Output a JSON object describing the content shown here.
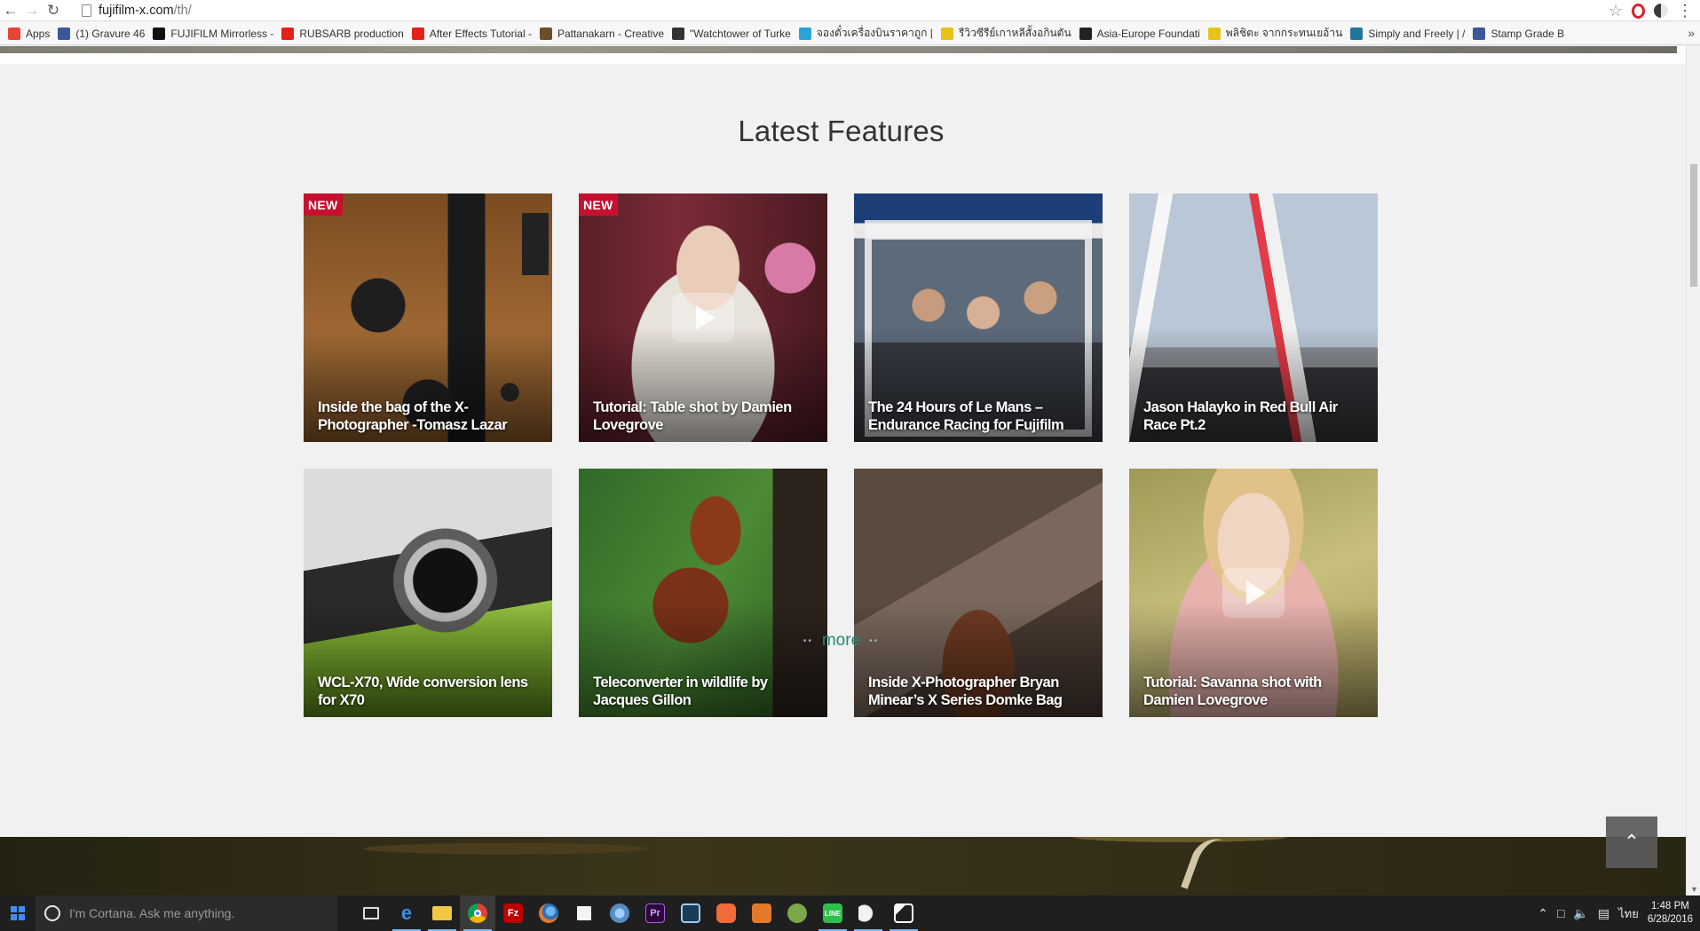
{
  "browser": {
    "url_host": "fujifilm-x.com",
    "url_path": "/th/",
    "bookmarks": [
      {
        "label": "Apps",
        "icon": "apps-grid-icon",
        "color": "#e94335"
      },
      {
        "label": "(1) Gravure 46",
        "icon": "facebook-icon",
        "color": "#3b5998"
      },
      {
        "label": "FUJIFILM Mirrorless -",
        "icon": "fujifilm-x-icon",
        "color": "#111111"
      },
      {
        "label": "RUBSARB production",
        "icon": "youtube-icon",
        "color": "#e62117"
      },
      {
        "label": "After Effects Tutorial -",
        "icon": "youtube-icon",
        "color": "#e62117"
      },
      {
        "label": "Pattanakarn - Creative",
        "icon": "page-icon",
        "color": "#6b4f2a"
      },
      {
        "label": "\"Watchtower of Turke",
        "icon": "film-icon",
        "color": "#333333"
      },
      {
        "label": "จองตั๋วเครื่องบินราคาถูก |",
        "icon": "plane-icon",
        "color": "#2aa3d9"
      },
      {
        "label": "รีวิวซีรีย์เกาหลีสั้งอกินตัน",
        "icon": "smiley-icon",
        "color": "#e8c21a"
      },
      {
        "label": "Asia-Europe Foundati",
        "icon": "asef-icon",
        "color": "#222222"
      },
      {
        "label": "พลิชิตะ จากกระทนเยอ้าน",
        "icon": "smiley-icon",
        "color": "#e8c21a"
      },
      {
        "label": "Simply and Freely | /",
        "icon": "wordpress-icon",
        "color": "#21759b"
      },
      {
        "label": "Stamp Grade B",
        "icon": "facebook-icon",
        "color": "#3b5998"
      }
    ]
  },
  "section": {
    "title": "Latest Features",
    "more_label": "more"
  },
  "features": [
    {
      "title": "Inside the bag of the X-Photographer -Tomasz Lazar",
      "badge": "NEW",
      "video": false
    },
    {
      "title": "Tutorial: Table shot by Damien Lovegrove",
      "badge": "NEW",
      "video": true
    },
    {
      "title": "The 24 Hours of Le Mans – Endurance Racing for Fujifilm",
      "badge": "",
      "video": false
    },
    {
      "title": "Jason Halayko in Red Bull Air Race Pt.2",
      "badge": "",
      "video": false
    },
    {
      "title": "WCL-X70, Wide conversion lens for X70",
      "badge": "",
      "video": false
    },
    {
      "title": "Teleconverter in wildlife by Jacques Gillon",
      "badge": "",
      "video": false
    },
    {
      "title": "Inside X-Photographer Bryan Minear’s X Series Domke Bag",
      "badge": "",
      "video": false
    },
    {
      "title": "Tutorial: Savanna shot with Damien Lovegrove",
      "badge": "",
      "video": true
    }
  ],
  "taskbar": {
    "search_placeholder": "I'm Cortana. Ask me anything.",
    "language": "ไทย",
    "time": "1:48 PM",
    "date": "6/28/2016"
  },
  "colors": {
    "badge": "#c8102e",
    "more_link": "#1f8c74",
    "page_bg": "#f1f1f1",
    "taskbar_bg": "#1f1f1f"
  }
}
